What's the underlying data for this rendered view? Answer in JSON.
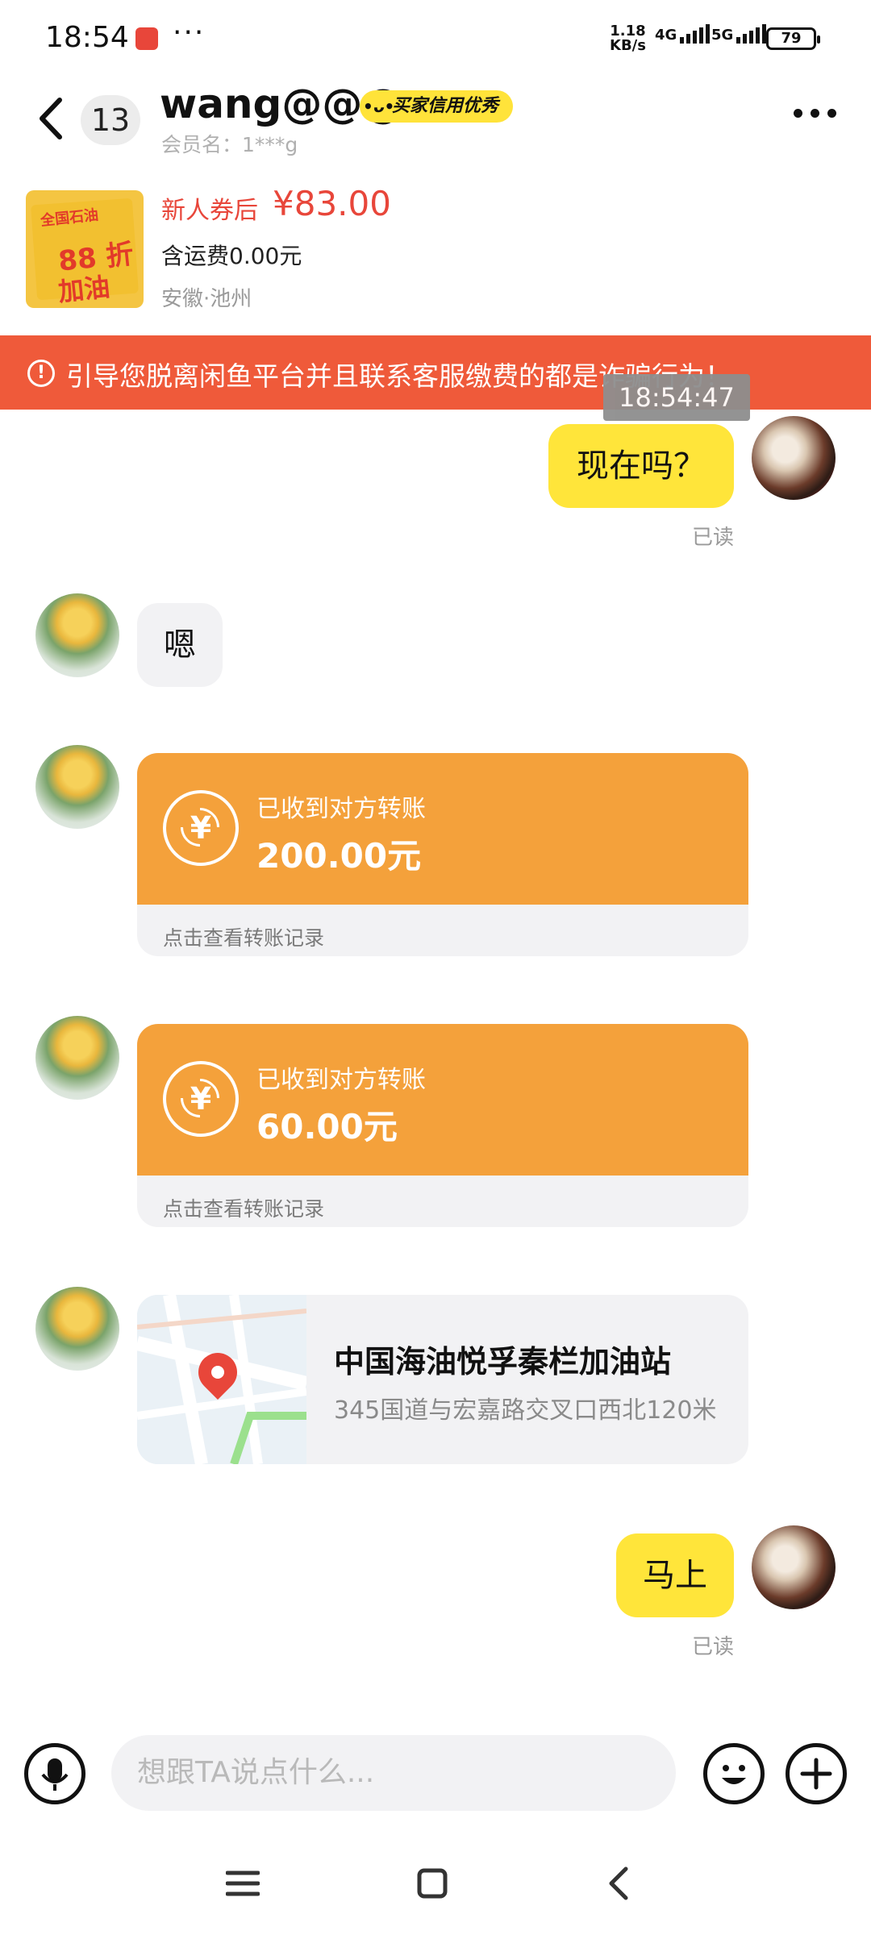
{
  "status_bar": {
    "time": "18:54",
    "more": "···",
    "net_speed_value": "1.18",
    "net_speed_unit": "KB/s",
    "net1": "4G",
    "net2": "5G",
    "battery": "79"
  },
  "header": {
    "unread_count": "13",
    "username": "wang@@@",
    "credit_badge": "买家信用优秀",
    "member_name": "会员名：1***g"
  },
  "product": {
    "image_text_top": "全国石油",
    "image_text_mid": "88 折",
    "image_text_bottom": "加油",
    "price_label": "新人券后",
    "price": "¥83.00",
    "shipping": "含运费0.00元",
    "location": "安徽·池州"
  },
  "warning": {
    "text": "引导您脱离闲鱼平台并且联系客服缴费的都是诈骗行为！",
    "timestamp_overlay": "18:54:47"
  },
  "messages": {
    "m1": {
      "text": "现在吗？",
      "status": "已读"
    },
    "m2": {
      "text": "嗯"
    },
    "m3": {
      "label": "已收到对方转账",
      "amount": "200.00元",
      "link": "点击查看转账记录",
      "icon": "yuan-refresh-icon"
    },
    "m4": {
      "label": "已收到对方转账",
      "amount": "60.00元",
      "link": "点击查看转账记录",
      "icon": "yuan-refresh-icon"
    },
    "m5": {
      "title": "中国海油悦孚秦栏加油站",
      "address": "345国道与宏嘉路交叉口西北120米"
    },
    "m6": {
      "text": "马上",
      "status": "已读"
    }
  },
  "input": {
    "placeholder": "想跟TA说点什么..."
  },
  "colors": {
    "brand_yellow": "#ffe53a",
    "warning_red": "#ef5a3a",
    "transfer_orange": "#f4a13b",
    "price_red": "#e8463a"
  }
}
